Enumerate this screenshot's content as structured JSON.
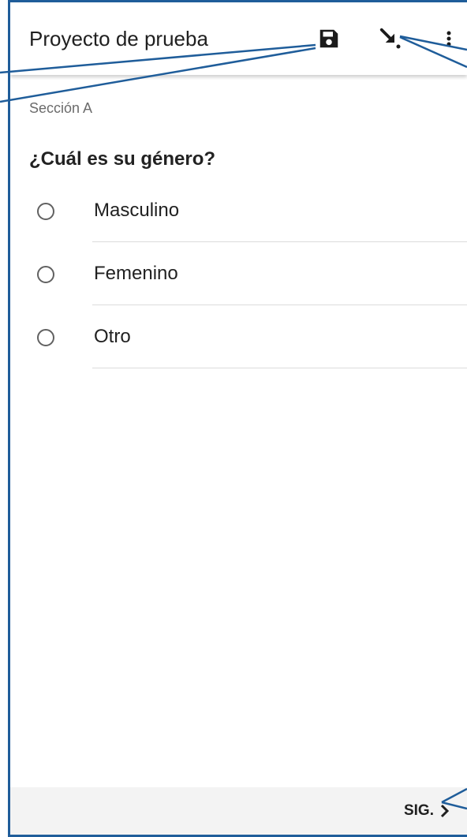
{
  "appbar": {
    "title": "Proyecto de prueba",
    "icons": [
      "save-icon",
      "goto-icon",
      "more-vert-icon"
    ]
  },
  "form": {
    "section": "Sección A",
    "question": "¿Cuál es su género?",
    "options": [
      {
        "label": "Masculino"
      },
      {
        "label": "Femenino"
      },
      {
        "label": "Otro"
      }
    ]
  },
  "footer": {
    "next_label": "SIG.",
    "next_icon": "chevron-right-icon"
  },
  "colors": {
    "callout": "#1f5d9a"
  }
}
